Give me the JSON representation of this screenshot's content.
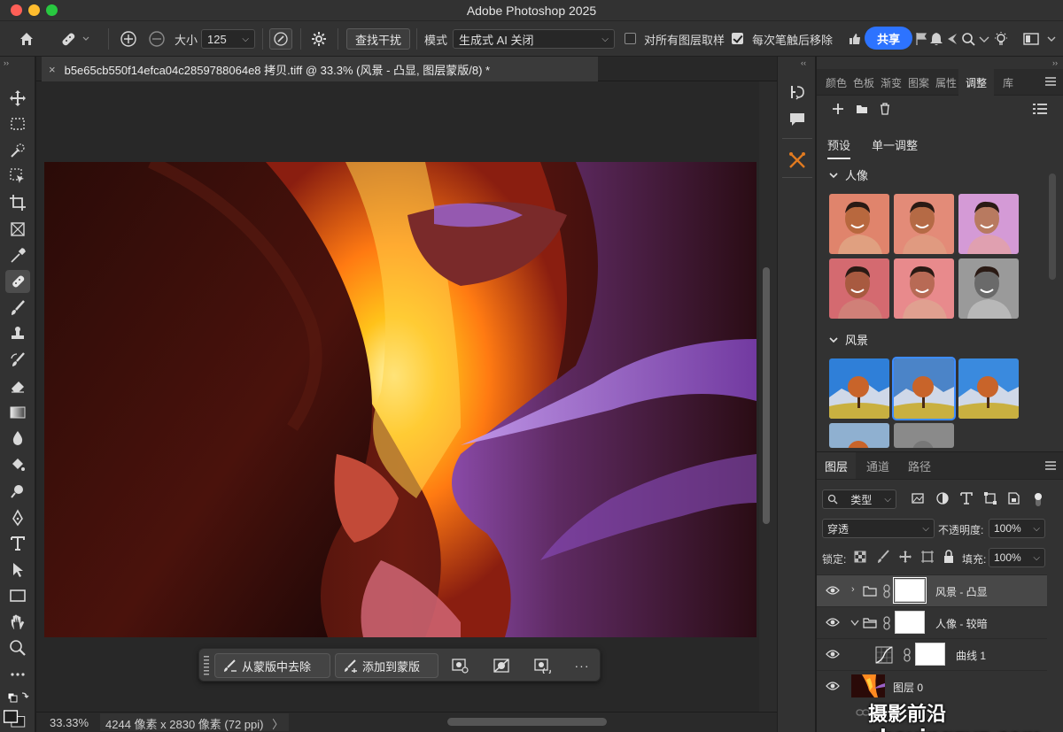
{
  "app": {
    "title": "Adobe Photoshop 2025"
  },
  "options_bar": {
    "size_label": "大小",
    "size_value": "125",
    "find_distractions_label": "查找干扰",
    "mode_label": "模式",
    "mode_value": "生成式 AI 关闭",
    "sample_all_layers_label": "对所有图层取样",
    "sample_all_layers_checked": false,
    "remove_after_stroke_label": "每次笔触后移除",
    "remove_after_stroke_checked": true,
    "share_label": "共享"
  },
  "document": {
    "tab_title": "b5e65cb550f14efca04c2859788064e8 拷贝.tiff @ 33.3% (风景 - 凸显, 图层蒙版/8) *",
    "close_glyph": "×"
  },
  "contextual_taskbar": {
    "remove_from_mask_label": "从蒙版中去除",
    "add_to_mask_label": "添加到蒙版",
    "more_glyph": "···"
  },
  "status_bar": {
    "zoom": "33.33%",
    "doc_info": "4244 像素 x 2830 像素 (72 ppi)",
    "arrow": "〉"
  },
  "right_panel": {
    "tabs": [
      "颜色",
      "色板",
      "渐变",
      "图案",
      "属性",
      "调整",
      "库"
    ],
    "active_tab": "调整",
    "sub_tabs": [
      "预设",
      "单一调整"
    ],
    "groups": [
      {
        "name": "人像"
      },
      {
        "name": "风景"
      }
    ]
  },
  "layers_panel": {
    "tabs": [
      "图层",
      "通道",
      "路径"
    ],
    "filter_kind": "类型",
    "blend_mode": "穿透",
    "opacity_label": "不透明度:",
    "opacity_value": "100%",
    "lock_label": "锁定:",
    "fill_label": "填充:",
    "fill_value": "100%",
    "layers": [
      {
        "name": "风景 - 凸显",
        "type": "group",
        "expanded": false,
        "selected": true
      },
      {
        "name": "人像 - 较暗",
        "type": "group",
        "expanded": true,
        "selected": false
      },
      {
        "name": "曲线 1",
        "type": "curves",
        "selected": false
      },
      {
        "name": "图层 0",
        "type": "pixel",
        "selected": false
      }
    ]
  },
  "watermark": "摄影前沿 sheyingzyz.com",
  "colors": {
    "accent": "#2d73ff",
    "selection_outline": "#3d8cff",
    "panel_bg": "#323232",
    "canvas_bg": "#282828"
  }
}
